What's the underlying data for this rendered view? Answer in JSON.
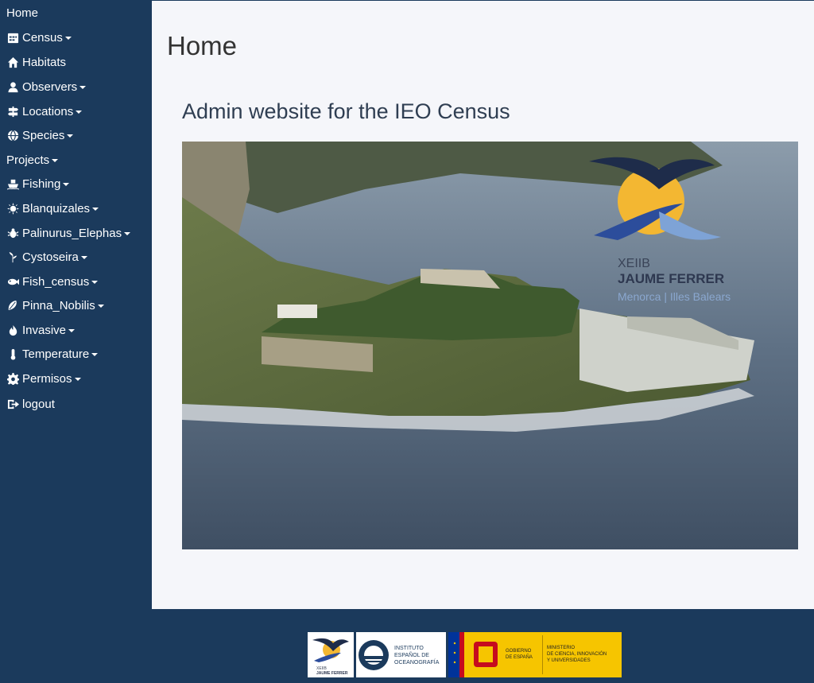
{
  "sidebar": {
    "items": [
      {
        "label": "Home",
        "icon": "",
        "dropdown": false
      },
      {
        "label": "Census",
        "icon": "calendar-icon",
        "dropdown": true
      },
      {
        "label": "Habitats",
        "icon": "home-icon",
        "dropdown": false
      },
      {
        "label": "Observers",
        "icon": "user-icon",
        "dropdown": true
      },
      {
        "label": "Locations",
        "icon": "signpost-icon",
        "dropdown": true
      },
      {
        "label": "Species",
        "icon": "globe-icon",
        "dropdown": true
      },
      {
        "label": "Projects",
        "icon": "",
        "dropdown": true
      },
      {
        "label": "Fishing",
        "icon": "boat-icon",
        "dropdown": true
      },
      {
        "label": "Blanquizales",
        "icon": "sun-icon",
        "dropdown": true
      },
      {
        "label": "Palinurus_Elephas",
        "icon": "bug-icon",
        "dropdown": true
      },
      {
        "label": "Cystoseira",
        "icon": "seaweed-icon",
        "dropdown": true
      },
      {
        "label": "Fish_census",
        "icon": "fish-icon",
        "dropdown": true
      },
      {
        "label": "Pinna_Nobilis",
        "icon": "shell-icon",
        "dropdown": true
      },
      {
        "label": "Invasive",
        "icon": "fire-icon",
        "dropdown": true
      },
      {
        "label": "Temperature",
        "icon": "thermometer-icon",
        "dropdown": true
      },
      {
        "label": "Permisos",
        "icon": "gear-icon",
        "dropdown": true
      },
      {
        "label": "logout",
        "icon": "logout-icon",
        "dropdown": false
      }
    ]
  },
  "main": {
    "title": "Home",
    "subtitle": "Admin website for the IEO Census",
    "hero_logo": {
      "line1": "XEIIB",
      "line2": "JAUME FERRER",
      "line3": "Menorca | Illes Balears"
    }
  },
  "footer": {
    "logo1": {
      "line1": "XEIIB",
      "line2": "JAUME FERRER"
    },
    "logo2": {
      "line1": "INSTITUTO",
      "line2": "ESPAÑOL DE",
      "line3": "OCEANOGRAFÍA"
    },
    "logo3": {
      "line1": "GOBIERNO",
      "line2": "DE ESPAÑA",
      "line3": "MINISTERIO",
      "line4": "DE CIENCIA, INNOVACIÓN",
      "line5": "Y UNIVERSIDADES"
    }
  },
  "colors": {
    "sidebar": "#1b3a5c",
    "main_bg": "#f5f6fa",
    "gov_yellow": "#f6c500"
  }
}
